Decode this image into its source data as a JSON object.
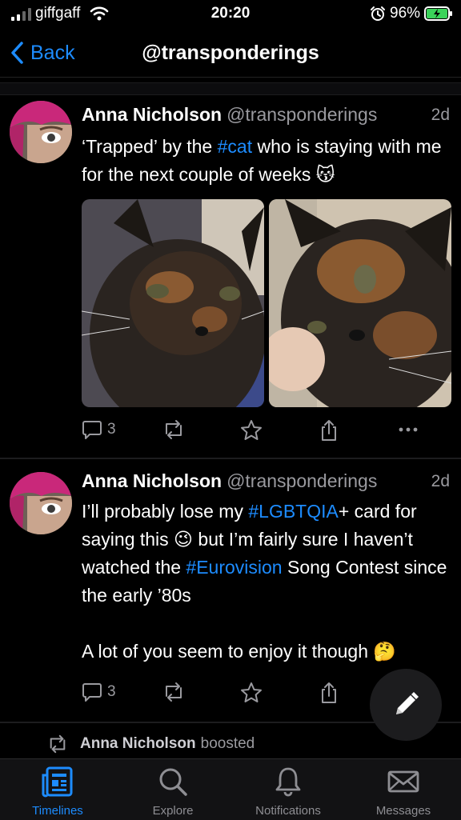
{
  "status_bar": {
    "carrier": "giffgaff",
    "time": "20:20",
    "battery": "96%"
  },
  "nav": {
    "back_label": "Back",
    "title": "@transponderings"
  },
  "posts": [
    {
      "author": "Anna Nicholson",
      "handle": "@transponderings",
      "age": "2d",
      "text_parts": [
        "‘Trapped’ by the ",
        "#cat",
        " who is staying with me for the next couple of weeks 😽"
      ],
      "replies": "3"
    },
    {
      "author": "Anna Nicholson",
      "handle": "@transponderings",
      "age": "2d",
      "text_parts": [
        "I’ll probably lose my ",
        "#LGBTQIA",
        "+ card for saying this 😉 but I’m fairly sure I haven’t watched the ",
        "#Eurovision",
        " Song Contest since the early ’80s"
      ],
      "text_second": "A lot of you seem to enjoy it though 🤔",
      "replies": "3"
    }
  ],
  "boost": {
    "who": "Anna Nicholson",
    "what": "boosted"
  },
  "tabs": [
    {
      "label": "Timelines",
      "icon": "timelines-icon",
      "active": true
    },
    {
      "label": "Explore",
      "icon": "search-icon",
      "active": false
    },
    {
      "label": "Notifications",
      "icon": "bell-icon",
      "active": false
    },
    {
      "label": "Messages",
      "icon": "envelope-icon",
      "active": false
    }
  ],
  "colors": {
    "accent": "#1d8cff",
    "background": "#000000",
    "secondary_text": "#9a9a9f"
  }
}
